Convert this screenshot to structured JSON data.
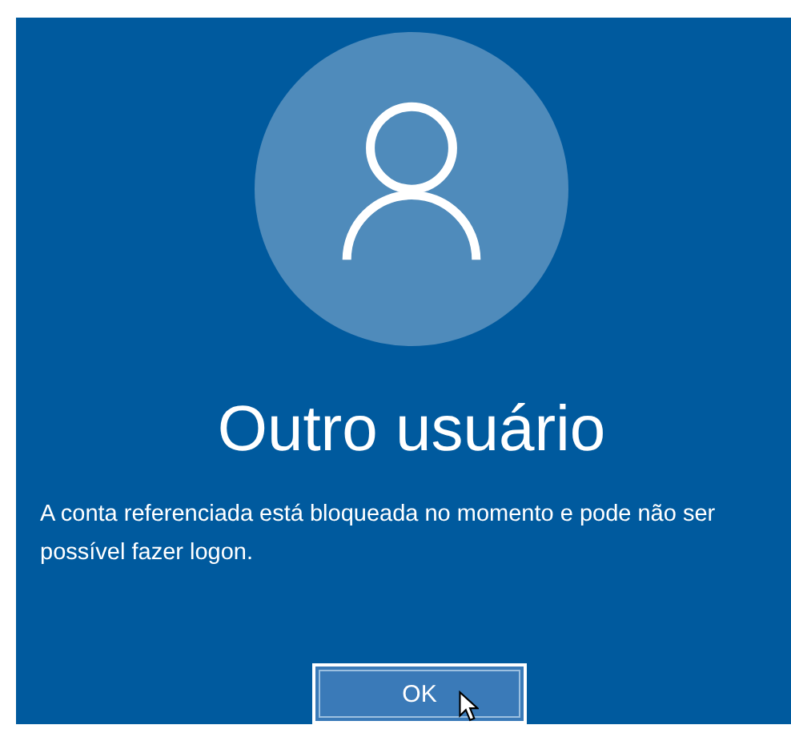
{
  "title": "Outro usuário",
  "message": "A conta referenciada está bloqueada no momento e pode não ser possível fazer logon.",
  "buttons": [
    "OK"
  ]
}
